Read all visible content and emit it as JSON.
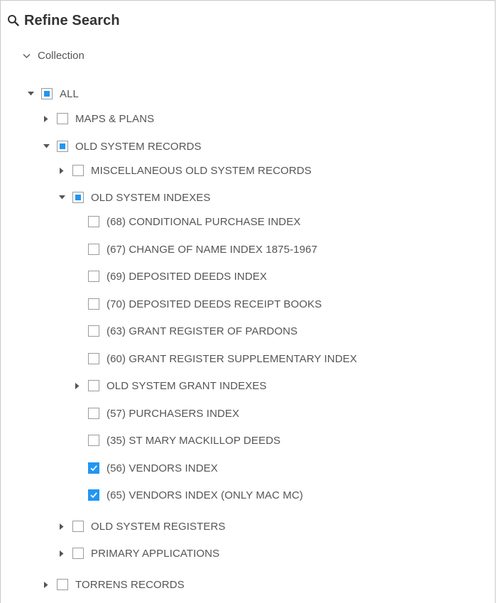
{
  "header": {
    "title": "Refine Search",
    "icon": "search-icon"
  },
  "facet": {
    "label": "Collection",
    "icon": "chevron-down-icon"
  },
  "colors": {
    "accent": "#2196f3",
    "border": "#9b9b9b",
    "text": "#555555"
  },
  "tree": [
    {
      "label": "ALL",
      "toggle": "expanded",
      "state": "partial"
    },
    {
      "label": "MAPS & PLANS",
      "toggle": "collapsed",
      "state": "unchecked"
    },
    {
      "label": "OLD SYSTEM RECORDS",
      "toggle": "expanded",
      "state": "partial"
    },
    {
      "label": "MISCELLANEOUS OLD SYSTEM RECORDS",
      "toggle": "collapsed",
      "state": "unchecked"
    },
    {
      "label": "OLD SYSTEM INDEXES",
      "toggle": "expanded",
      "state": "partial"
    },
    {
      "label": "(68) CONDITIONAL PURCHASE INDEX",
      "toggle": "none",
      "state": "unchecked"
    },
    {
      "label": "(67) CHANGE OF NAME INDEX 1875-1967",
      "toggle": "none",
      "state": "unchecked"
    },
    {
      "label": "(69) DEPOSITED DEEDS INDEX",
      "toggle": "none",
      "state": "unchecked"
    },
    {
      "label": "(70) DEPOSITED DEEDS RECEIPT BOOKS",
      "toggle": "none",
      "state": "unchecked"
    },
    {
      "label": "(63) GRANT REGISTER OF PARDONS",
      "toggle": "none",
      "state": "unchecked"
    },
    {
      "label": "(60) GRANT REGISTER SUPPLEMENTARY INDEX",
      "toggle": "none",
      "state": "unchecked"
    },
    {
      "label": "OLD SYSTEM GRANT INDEXES",
      "toggle": "collapsed",
      "state": "unchecked"
    },
    {
      "label": "(57) PURCHASERS INDEX",
      "toggle": "none",
      "state": "unchecked"
    },
    {
      "label": "(35) ST MARY MACKILLOP DEEDS",
      "toggle": "none",
      "state": "unchecked"
    },
    {
      "label": "(56) VENDORS INDEX",
      "toggle": "none",
      "state": "checked"
    },
    {
      "label": "(65) VENDORS INDEX (ONLY MAC MC)",
      "toggle": "none",
      "state": "checked"
    },
    {
      "label": "OLD SYSTEM REGISTERS",
      "toggle": "collapsed",
      "state": "unchecked"
    },
    {
      "label": "PRIMARY APPLICATIONS",
      "toggle": "collapsed",
      "state": "unchecked"
    },
    {
      "label": "TORRENS RECORDS",
      "toggle": "collapsed",
      "state": "unchecked"
    }
  ]
}
